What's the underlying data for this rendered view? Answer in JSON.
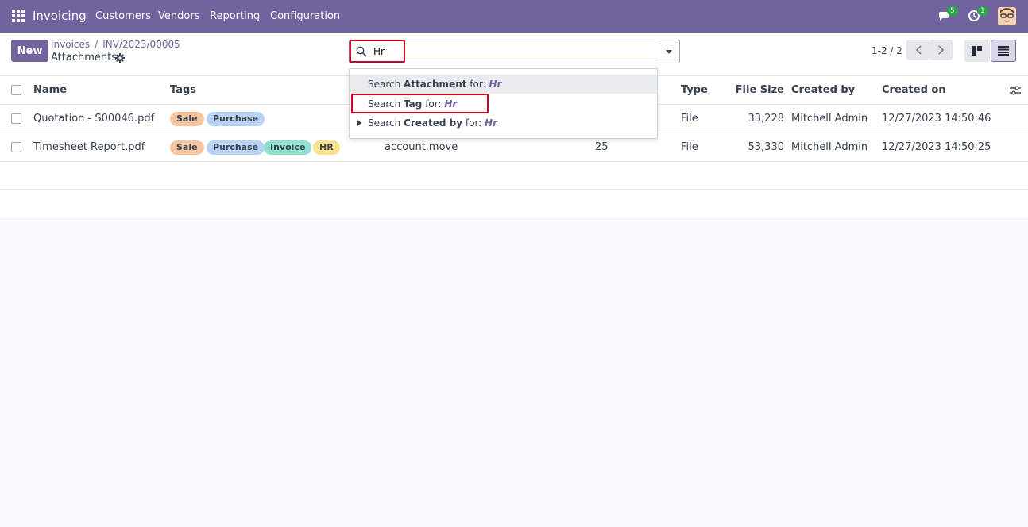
{
  "navbar": {
    "brand": "Invoicing",
    "menus": [
      "Customers",
      "Vendors",
      "Reporting",
      "Configuration"
    ],
    "messages_count": "5",
    "activities_count": "1"
  },
  "control": {
    "new_label": "New",
    "breadcrumb": [
      "Invoices",
      "INV/2023/00005"
    ],
    "title": "Attachments",
    "search_value": "Hr",
    "pager": "1-2 / 2"
  },
  "search_suggestions": [
    {
      "prefix": "Search ",
      "field": "Attachment",
      "mid": " for: ",
      "term": "Hr"
    },
    {
      "prefix": "Search ",
      "field": "Tag",
      "mid": " for: ",
      "term": "Hr"
    },
    {
      "prefix": "Search ",
      "field": "Created by",
      "mid": " for: ",
      "term": "Hr"
    }
  ],
  "table": {
    "headers": {
      "name": "Name",
      "tags": "Tags",
      "type": "Type",
      "file_size": "File Size",
      "created_by": "Created by",
      "created_on": "Created on"
    },
    "rows": [
      {
        "name": "Quotation - S00046.pdf",
        "tags": [
          "Sale",
          "Purchase"
        ],
        "model": "",
        "res_id": "",
        "type": "File",
        "file_size": "33,228",
        "created_by": "Mitchell Admin",
        "created_on": "12/27/2023 14:50:46"
      },
      {
        "name": "Timesheet Report.pdf",
        "tags": [
          "Sale",
          "Purchase",
          "Invoice",
          "HR"
        ],
        "model": "account.move",
        "res_id": "25",
        "type": "File",
        "file_size": "53,330",
        "created_by": "Mitchell Admin",
        "created_on": "12/27/2023 14:50:25"
      }
    ]
  },
  "tag_colors": {
    "Sale": "#f7c59f",
    "Purchase": "#b9d3f5",
    "Invoice": "#8fe0cf",
    "HR": "#fbe38e"
  },
  "accent": "#71639e",
  "highlight": "#d0021b"
}
